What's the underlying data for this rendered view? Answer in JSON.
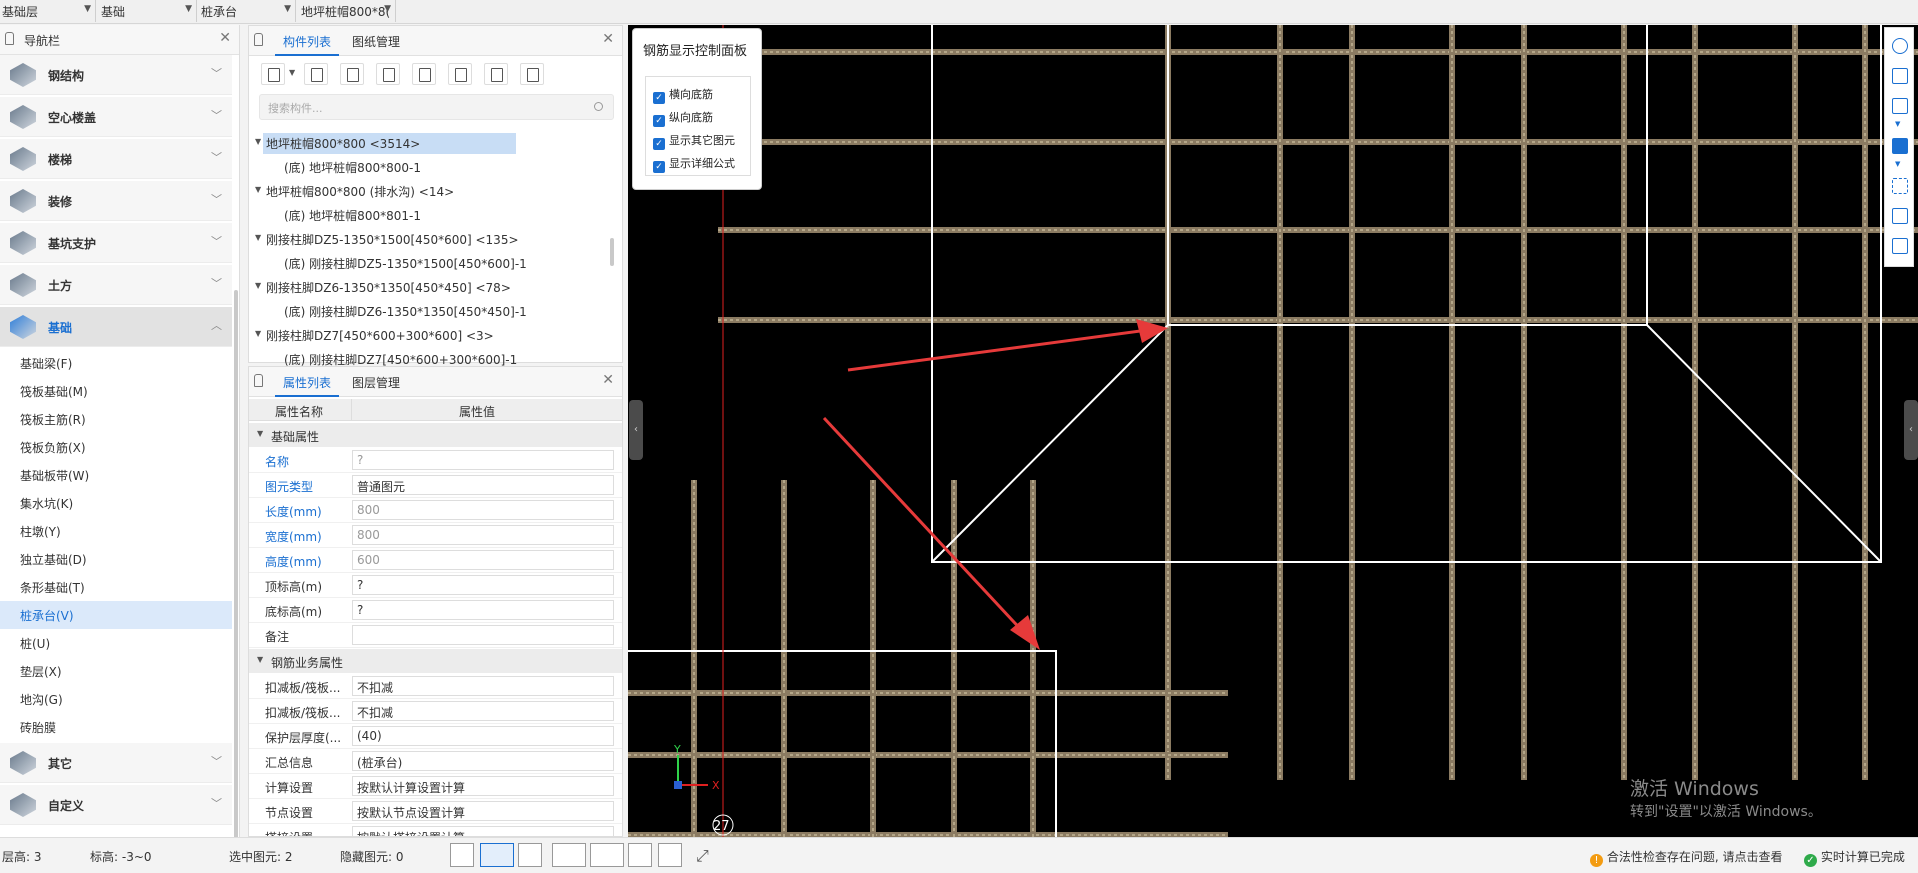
{
  "topbar": {
    "floor": "基础层",
    "category": "基础",
    "type": "桩承台",
    "component": "地坪桩帽800*8("
  },
  "nav": {
    "title": "导航栏",
    "cats_top": [
      {
        "label": "钢结构",
        "icon": "steel-structure-icon"
      },
      {
        "label": "空心楼盖",
        "icon": "hollow-floor-icon"
      },
      {
        "label": "楼梯",
        "icon": "stairs-icon"
      },
      {
        "label": "装修",
        "icon": "decoration-icon"
      },
      {
        "label": "基坑支护",
        "icon": "foundation-pit-icon"
      },
      {
        "label": "土方",
        "icon": "earthwork-icon"
      },
      {
        "label": "基础",
        "icon": "foundation-icon"
      }
    ],
    "items": [
      "基础梁(F)",
      "筏板基础(M)",
      "筏板主筋(R)",
      "筏板负筋(X)",
      "基础板带(W)",
      "集水坑(K)",
      "柱墩(Y)",
      "独立基础(D)",
      "条形基础(T)",
      "桩承台(V)",
      "桩(U)",
      "垫层(X)",
      "地沟(G)",
      "砖胎膜"
    ],
    "cats_bottom": [
      {
        "label": "其它",
        "icon": "other-icon"
      },
      {
        "label": "自定义",
        "icon": "custom-icon"
      }
    ]
  },
  "comp": {
    "tab1": "构件列表",
    "tab2": "图纸管理",
    "search_placeholder": "搜索构件...",
    "tree": [
      {
        "text": "地坪桩帽800*800 <3514>",
        "level": 0,
        "sel": true
      },
      {
        "text": "(底) 地坪桩帽800*800-1",
        "level": 1
      },
      {
        "text": "地坪桩帽800*800 (排水沟) <14>",
        "level": 0
      },
      {
        "text": "(底) 地坪桩帽800*801-1",
        "level": 1
      },
      {
        "text": "刚接柱脚DZ5-1350*1500[450*600] <135>",
        "level": 0
      },
      {
        "text": "(底) 刚接柱脚DZ5-1350*1500[450*600]-1",
        "level": 1
      },
      {
        "text": "刚接柱脚DZ6-1350*1350[450*450] <78>",
        "level": 0
      },
      {
        "text": "(底) 刚接柱脚DZ6-1350*1350[450*450]-1",
        "level": 1
      },
      {
        "text": "刚接柱脚DZ7[450*600+300*600] <3>",
        "level": 0
      },
      {
        "text": "(底) 刚接柱脚DZ7[450*600+300*600]-1",
        "level": 1
      }
    ]
  },
  "prop": {
    "tab1": "属性列表",
    "tab2": "图层管理",
    "col_name": "属性名称",
    "col_value": "属性值",
    "sect1": "基础属性",
    "rows1": [
      {
        "k": "名称",
        "v": "?",
        "blue": true,
        "grey": true
      },
      {
        "k": "图元类型",
        "v": "普通图元",
        "blue": true
      },
      {
        "k": "长度(mm)",
        "v": "800",
        "blue": true,
        "grey": true
      },
      {
        "k": "宽度(mm)",
        "v": "800",
        "blue": true,
        "grey": true
      },
      {
        "k": "高度(mm)",
        "v": "600",
        "blue": true,
        "grey": true
      },
      {
        "k": "顶标高(m)",
        "v": "?"
      },
      {
        "k": "底标高(m)",
        "v": "?"
      },
      {
        "k": "备注",
        "v": ""
      }
    ],
    "sect2": "钢筋业务属性",
    "rows2": [
      {
        "k": "扣减板/筏板...",
        "v": "不扣减"
      },
      {
        "k": "扣减板/筏板...",
        "v": "不扣减"
      },
      {
        "k": "保护层厚度(...",
        "v": "(40)"
      },
      {
        "k": "汇总信息",
        "v": "(桩承台)"
      },
      {
        "k": "计算设置",
        "v": "按默认计算设置计算"
      },
      {
        "k": "节点设置",
        "v": "按默认节点设置计算"
      },
      {
        "k": "搭接设置",
        "v": "按默认搭接设置计算"
      }
    ]
  },
  "panel": {
    "title": "钢筋显示控制面板",
    "checks": [
      "横向底筋",
      "纵向底筋",
      "显示其它图元",
      "显示详细公式"
    ]
  },
  "canvas": {
    "axis_x": "X",
    "axis_y": "Y",
    "marker": "27",
    "rebar_color": "#8b7b62",
    "arrow_color": "#e63a3a"
  },
  "watermark": {
    "l1": "激活 Windows",
    "l2": "转到\"设置\"以激活 Windows。"
  },
  "status": {
    "floor": "层高: 3",
    "elev": "标高: -3~0",
    "selected": "选中图元: 2",
    "hidden": "隐藏图元: 0",
    "warn": "合法性检查存在问题, 请点击查看",
    "calc": "实时计算已完成",
    "warn_glyph": "!",
    "calc_glyph": "✓"
  }
}
